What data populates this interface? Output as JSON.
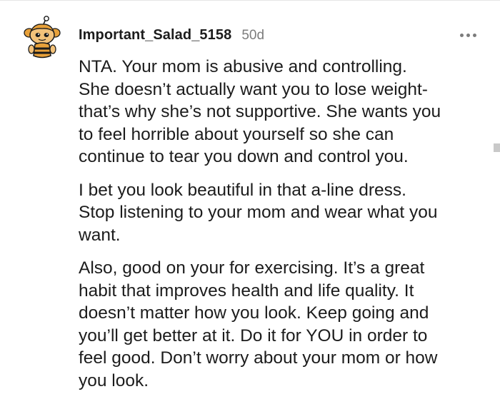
{
  "comment": {
    "author": "Important_Salad_5158",
    "age": "50d",
    "menu_icon": "more-horizontal-icon",
    "avatar_icon": "snoo-avatar-icon",
    "paragraphs": [
      {
        "lines": [
          "NTA. Your mom is abusive and controlling.",
          "She doesn’t actually want you to lose weight-",
          "that’s why she’s not supportive. She wants you",
          "to feel horrible about yourself so she can",
          "continue to tear you down and control you."
        ]
      },
      {
        "lines": [
          "I bet you look beautiful in that a-line dress.",
          "Stop listening to your mom and wear what you",
          "want."
        ]
      },
      {
        "lines": [
          "Also, good on your for exercising. It’s a great",
          "habit that improves health and life quality. It",
          "doesn’t matter how you look. Keep going and",
          "you’ll get better at it. Do it for YOU in order to",
          "feel good. Don’t worry about your mom or how",
          "you look."
        ]
      }
    ]
  },
  "colors": {
    "text": "#1c1c1c",
    "muted": "#7c7c7c",
    "avatar_orange": "#e8a13a",
    "avatar_dark": "#1a1a1a"
  }
}
